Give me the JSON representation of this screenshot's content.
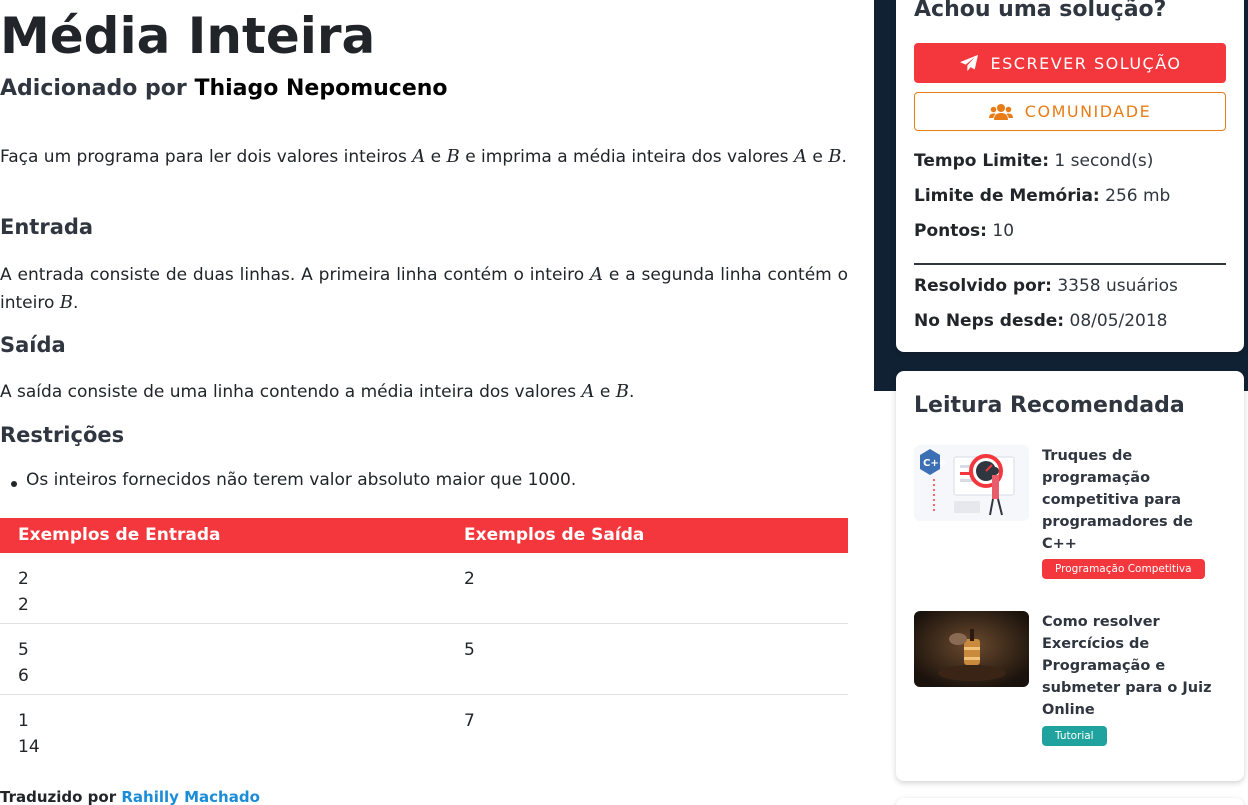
{
  "problem": {
    "title": "Média Inteira",
    "author_prefix": "Adicionado por",
    "author": "Thiago Nepomuceno",
    "statement_p1": "Faça um programa para ler dois valores inteiros",
    "var_a": "A",
    "conj": "e",
    "var_b": "B",
    "statement_p2": "e imprima a média inteira dos valores",
    "period": ".",
    "input_heading": "Entrada",
    "input_p1": "A entrada consiste de duas linhas. A primeira linha contém o inteiro",
    "input_p2": "e a segunda linha contém o inteiro",
    "output_heading": "Saída",
    "output_p1": "A saída consiste de uma linha contendo a média inteira dos valores",
    "restrictions_heading": "Restrições",
    "restriction_1": "Os inteiros fornecidos não terem valor absoluto maior que 1000.",
    "examples": {
      "input_header": "Exemplos de Entrada",
      "output_header": "Exemplos de Saída",
      "rows": [
        {
          "input": "2\n2",
          "output": "2"
        },
        {
          "input": "5\n6",
          "output": "5"
        },
        {
          "input": "1\n14",
          "output": "7"
        }
      ]
    },
    "translated_prefix": "Traduzido por",
    "translator": "Rahilly Machado"
  },
  "sidebar": {
    "card_title": "Achou uma solução?",
    "write_button": "ESCREVER SOLUÇÃO",
    "community_button": "COMUNIDADE",
    "time_limit_label": "Tempo Limite:",
    "time_limit": "1 second(s)",
    "memory_label": "Limite de Memória:",
    "memory": "256 mb",
    "points_label": "Pontos:",
    "points": "10",
    "solved_label": "Resolvido por:",
    "solved": "3358 usuários",
    "since_label": "No Neps desde:",
    "since": "08/05/2018",
    "reading_title": "Leitura Recomendada",
    "readings": [
      {
        "title": "Truques de programação competitiva para programadores de C++",
        "badge": "Programação Competitiva",
        "badge_color": "#f3373d"
      },
      {
        "title": "Como resolver Exercícios de Programação e submeter para o Juiz Online",
        "badge": "Tutorial",
        "badge_color": "#20a39e"
      }
    ]
  },
  "colors": {
    "accent": "#f3373d",
    "outline": "#e87d18",
    "navy": "#102133",
    "link": "#1b8dd8"
  }
}
